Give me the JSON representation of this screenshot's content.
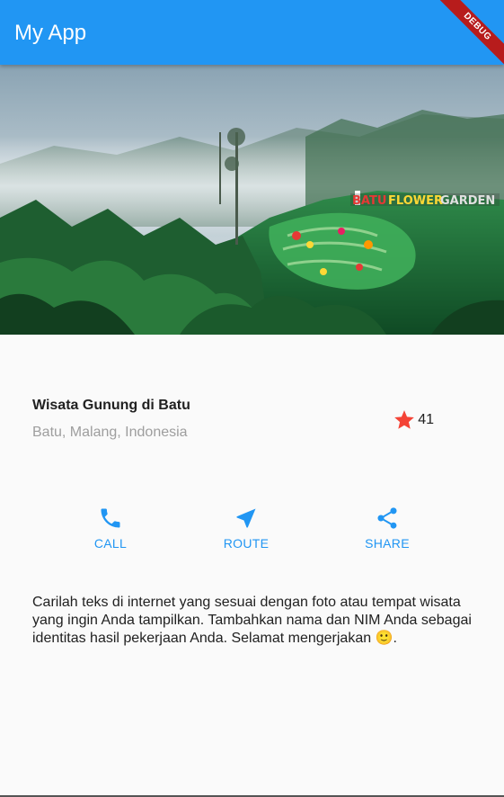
{
  "app": {
    "title": "My App",
    "debug_label": "DEBUG"
  },
  "colors": {
    "primary": "#2196f3",
    "star": "#f44336",
    "debug_banner": "#b71c1c"
  },
  "image": {
    "description": "Foggy green mountain landscape with colorful garden terraces",
    "visible_sign_text": "BATU FLOWER GARDEN"
  },
  "place": {
    "name": "Wisata Gunung di Batu",
    "location": "Batu, Malang, Indonesia",
    "rating_icon": "star-icon",
    "rating_count": "41"
  },
  "actions": [
    {
      "label": "CALL",
      "icon": "phone-icon"
    },
    {
      "label": "ROUTE",
      "icon": "near-me-icon"
    },
    {
      "label": "SHARE",
      "icon": "share-icon"
    }
  ],
  "description": "Carilah teks di internet yang sesuai dengan foto atau tempat wisata yang ingin Anda tampilkan. Tambahkan nama dan NIM Anda sebagai identitas hasil pekerjaan Anda. Selamat mengerjakan 🙂."
}
